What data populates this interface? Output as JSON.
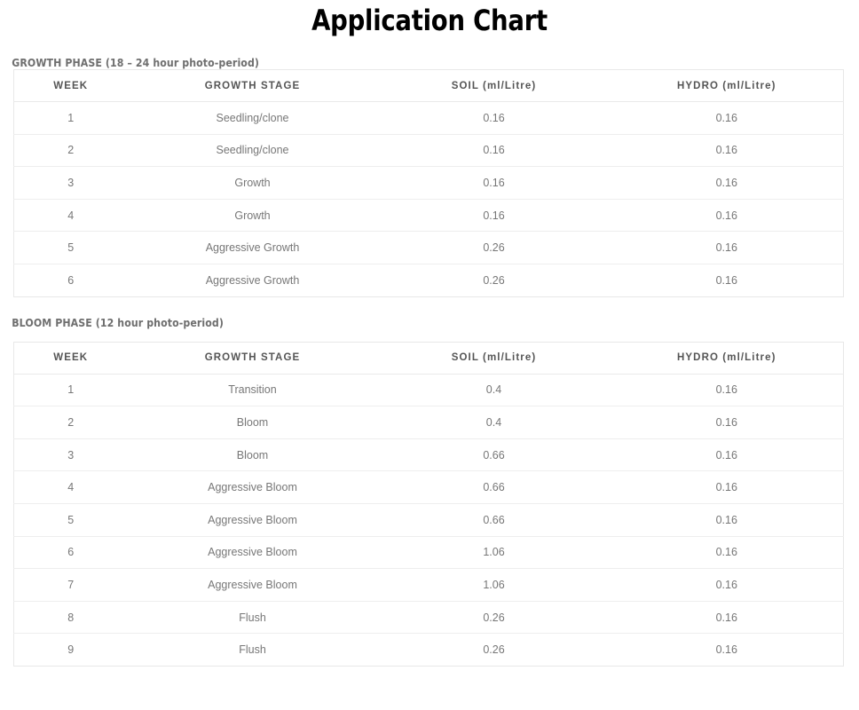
{
  "page": {
    "title": "Application Chart"
  },
  "sections": [
    {
      "id": "growth-phase",
      "heading": "GROWTH PHASE (18 – 24 hour photo-period)",
      "columns": [
        "WEEK",
        "GROWTH STAGE",
        "SOIL (ml/Litre)",
        "HYDRO (ml/Litre)"
      ],
      "rows": [
        {
          "week": "1",
          "stage": "Seedling/clone",
          "soil": "0.16",
          "hydro": "0.16"
        },
        {
          "week": "2",
          "stage": "Seedling/clone",
          "soil": "0.16",
          "hydro": "0.16"
        },
        {
          "week": "3",
          "stage": "Growth",
          "soil": "0.16",
          "hydro": "0.16"
        },
        {
          "week": "4",
          "stage": "Growth",
          "soil": "0.16",
          "hydro": "0.16"
        },
        {
          "week": "5",
          "stage": "Aggressive Growth",
          "soil": "0.26",
          "hydro": "0.16"
        },
        {
          "week": "6",
          "stage": "Aggressive Growth",
          "soil": "0.26",
          "hydro": "0.16"
        }
      ]
    },
    {
      "id": "bloom-phase",
      "heading": "BLOOM PHASE (12 hour photo-period)",
      "columns": [
        "WEEK",
        "GROWTH STAGE",
        "SOIL (ml/Litre)",
        "HYDRO (ml/Litre)"
      ],
      "rows": [
        {
          "week": "1",
          "stage": "Transition",
          "soil": "0.4",
          "hydro": "0.16"
        },
        {
          "week": "2",
          "stage": "Bloom",
          "soil": "0.4",
          "hydro": "0.16"
        },
        {
          "week": "3",
          "stage": "Bloom",
          "soil": "0.66",
          "hydro": "0.16"
        },
        {
          "week": "4",
          "stage": "Aggressive Bloom",
          "soil": "0.66",
          "hydro": "0.16"
        },
        {
          "week": "5",
          "stage": "Aggressive Bloom",
          "soil": "0.66",
          "hydro": "0.16"
        },
        {
          "week": "6",
          "stage": "Aggressive Bloom",
          "soil": "1.06",
          "hydro": "0.16"
        },
        {
          "week": "7",
          "stage": "Aggressive Bloom",
          "soil": "1.06",
          "hydro": "0.16"
        },
        {
          "week": "8",
          "stage": "Flush",
          "soil": "0.26",
          "hydro": "0.16"
        },
        {
          "week": "9",
          "stage": "Flush",
          "soil": "0.26",
          "hydro": "0.16"
        }
      ]
    }
  ],
  "chart_data": {
    "type": "table",
    "title": "Application Chart",
    "tables": [
      {
        "name": "GROWTH PHASE (18 – 24 hour photo-period)",
        "columns": [
          "WEEK",
          "GROWTH STAGE",
          "SOIL (ml/Litre)",
          "HYDRO (ml/Litre)"
        ],
        "rows": [
          [
            "1",
            "Seedling/clone",
            0.16,
            0.16
          ],
          [
            "2",
            "Seedling/clone",
            0.16,
            0.16
          ],
          [
            "3",
            "Growth",
            0.16,
            0.16
          ],
          [
            "4",
            "Growth",
            0.16,
            0.16
          ],
          [
            "5",
            "Aggressive Growth",
            0.26,
            0.16
          ],
          [
            "6",
            "Aggressive Growth",
            0.26,
            0.16
          ]
        ]
      },
      {
        "name": "BLOOM PHASE (12 hour photo-period)",
        "columns": [
          "WEEK",
          "GROWTH STAGE",
          "SOIL (ml/Litre)",
          "HYDRO (ml/Litre)"
        ],
        "rows": [
          [
            "1",
            "Transition",
            0.4,
            0.16
          ],
          [
            "2",
            "Bloom",
            0.4,
            0.16
          ],
          [
            "3",
            "Bloom",
            0.66,
            0.16
          ],
          [
            "4",
            "Aggressive Bloom",
            0.66,
            0.16
          ],
          [
            "5",
            "Aggressive Bloom",
            0.66,
            0.16
          ],
          [
            "6",
            "Aggressive Bloom",
            1.06,
            0.16
          ],
          [
            "7",
            "Aggressive Bloom",
            1.06,
            0.16
          ],
          [
            "8",
            "Flush",
            0.26,
            0.16
          ],
          [
            "9",
            "Flush",
            0.26,
            0.16
          ]
        ]
      }
    ]
  }
}
